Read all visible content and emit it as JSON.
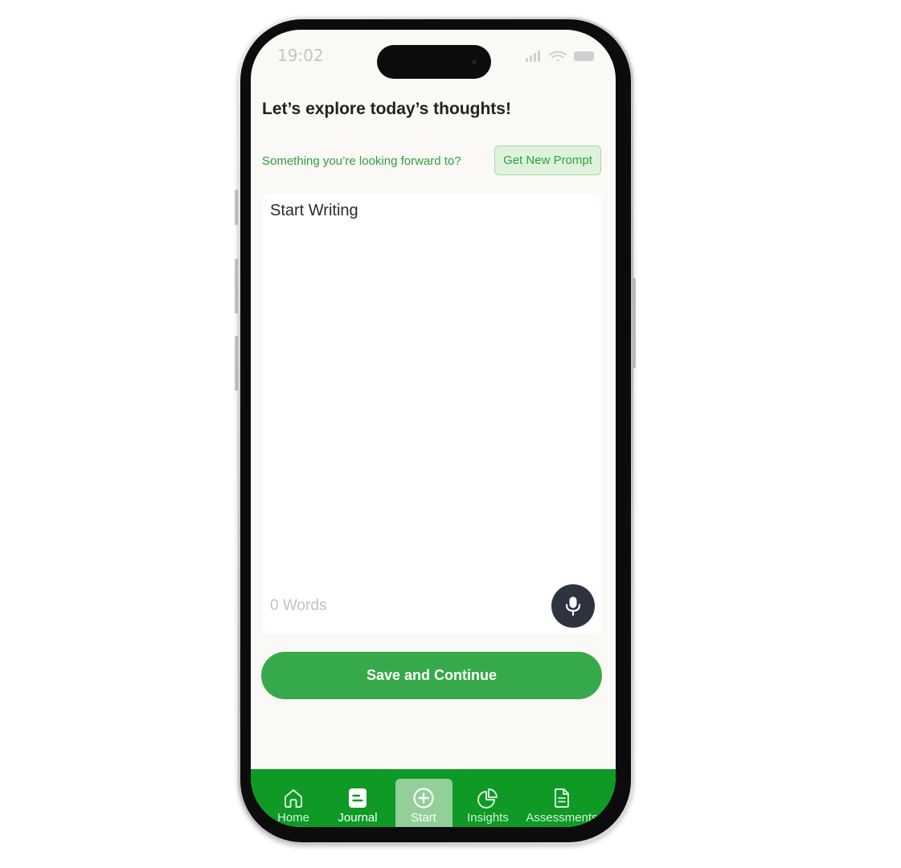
{
  "status_bar": {
    "time": "19:02"
  },
  "header": {
    "title": "Let’s explore today’s thoughts!",
    "prompt": "Something you’re looking forward to?",
    "new_prompt_label": "Get New Prompt"
  },
  "editor": {
    "placeholder": "Start Writing",
    "word_count": "0 Words"
  },
  "actions": {
    "save_label": "Save and Continue"
  },
  "nav": {
    "items": [
      {
        "label": "Home",
        "icon": "home-icon"
      },
      {
        "label": "Journal",
        "icon": "journal-icon"
      },
      {
        "label": "Start",
        "icon": "plus-circle-icon",
        "selected": true
      },
      {
        "label": "Insights",
        "icon": "pie-chart-icon"
      },
      {
        "label": "Assessments",
        "icon": "document-icon"
      }
    ]
  },
  "colors": {
    "brand_green": "#0e9a25",
    "button_green": "#36a94a",
    "prompt_green": "#2f9e3f",
    "mic_button": "#2d3440",
    "screen_background": "#faf9f5"
  }
}
